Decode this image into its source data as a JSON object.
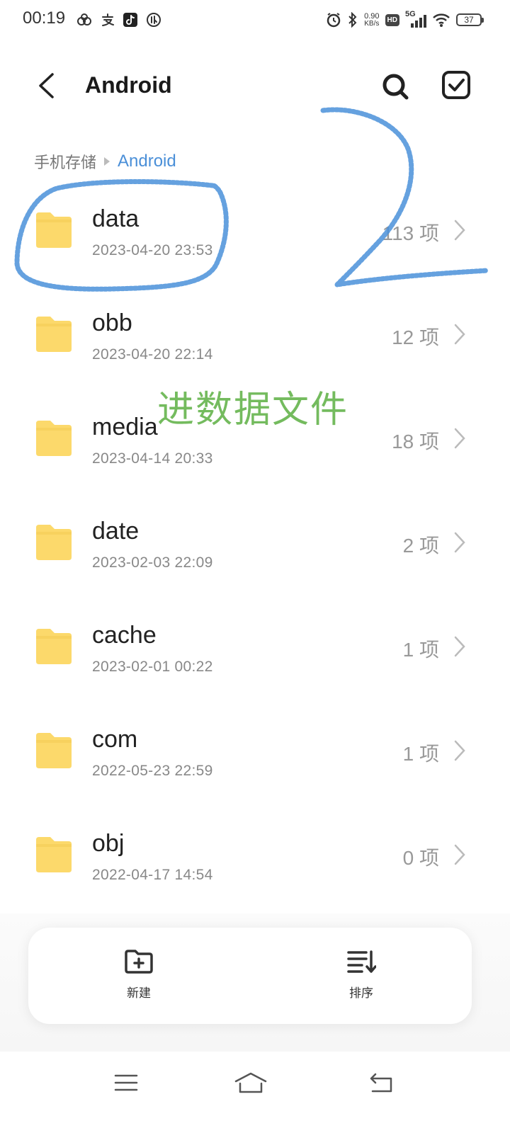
{
  "status_bar": {
    "time": "00:19",
    "left_icons": [
      "cloud-app-icon",
      "alipay-icon",
      "tiktok-icon",
      "app-circle-icon"
    ],
    "net_speed_value": "0.90",
    "net_speed_unit": "KB/s",
    "hd": "HD",
    "network": "5G",
    "battery": "37"
  },
  "header": {
    "title": "Android",
    "back_icon": "chevron-left-icon",
    "search_icon": "search-icon",
    "select_icon": "checkbox-icon"
  },
  "breadcrumb": {
    "root": "手机存储",
    "current": "Android"
  },
  "files": [
    {
      "name": "data",
      "date": "2023-04-20  23:53",
      "count": "113 项"
    },
    {
      "name": "obb",
      "date": "2023-04-20  22:14",
      "count": "12 项"
    },
    {
      "name": "media",
      "date": "2023-04-14  20:33",
      "count": "18 项"
    },
    {
      "name": "date",
      "date": "2023-02-03  22:09",
      "count": "2 项"
    },
    {
      "name": "cache",
      "date": "2023-02-01  00:22",
      "count": "1 项"
    },
    {
      "name": "com",
      "date": "2022-05-23  22:59",
      "count": "1 项"
    },
    {
      "name": "obj",
      "date": "2022-04-17  14:54",
      "count": "0 项"
    }
  ],
  "toolbar": {
    "new_label": "新建",
    "sort_label": "排序"
  },
  "annotation": {
    "text": "进数据文件",
    "text_color": "#74bb5e",
    "scribble_color": "#4a90d9"
  },
  "colors": {
    "folder": "#fcd96b",
    "accent": "#4a8fd8"
  }
}
